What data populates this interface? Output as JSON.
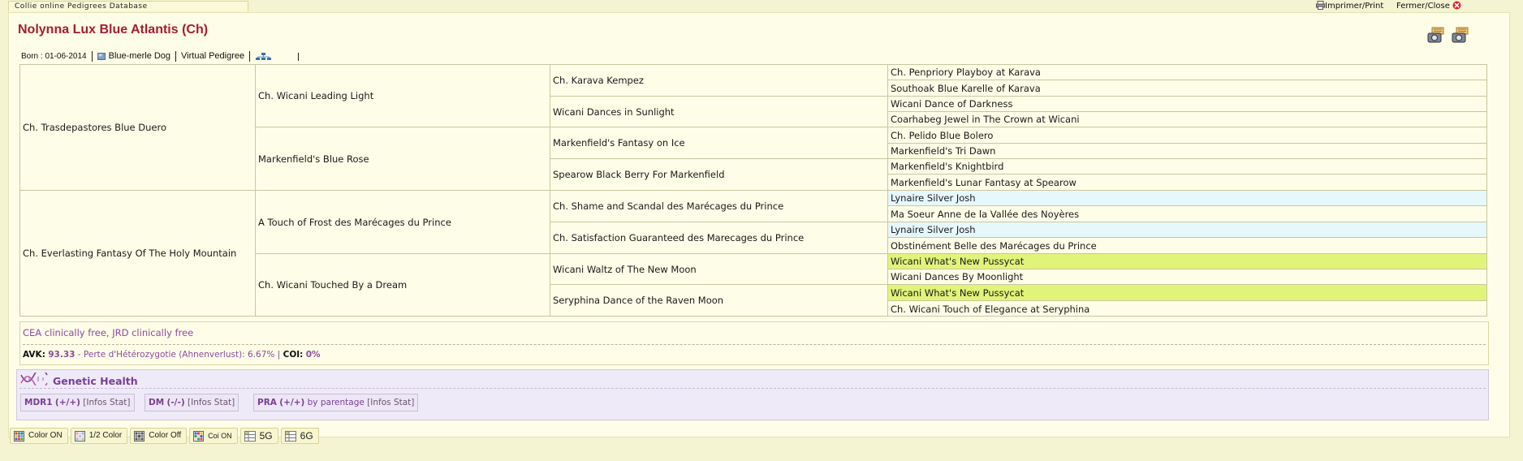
{
  "app": {
    "tab_title": "Collie online Pedigrees Database",
    "print_label": "Imprimer/Print",
    "close_label": "Fermer/Close"
  },
  "dog": {
    "title": "Nolynna Lux Blue Atlantis (Ch)",
    "born": "Born : 01-06-2014",
    "color_sex": "Blue-merle Dog",
    "virtual_pedigree": "Virtual Pedigree"
  },
  "pedigree": {
    "gen1": [
      "Ch. Trasdepastores Blue Duero",
      "Ch. Everlasting Fantasy Of The Holy Mountain"
    ],
    "gen2": [
      "Ch. Wicani Leading Light",
      "Markenfield's Blue Rose",
      "A Touch of Frost des Marécages du Prince",
      "Ch. Wicani Touched By a Dream"
    ],
    "gen3": [
      "Ch. Karava Kempez",
      "Wicani Dances in Sunlight",
      "Markenfield's Fantasy on Ice",
      "Spearow Black Berry For Markenfield",
      "Ch. Shame and Scandal des Marécages du Prince",
      "Ch. Satisfaction Guaranteed des Marecages du Prince",
      "Wicani Waltz of The New Moon",
      "Seryphina Dance of the Raven Moon"
    ],
    "gen4": [
      {
        "name": "Ch. Penpriory Playboy at Karava",
        "hl": ""
      },
      {
        "name": "Southoak Blue Karelle of Karava",
        "hl": ""
      },
      {
        "name": "Wicani Dance of Darkness",
        "hl": ""
      },
      {
        "name": "Coarhabeg Jewel in The Crown at Wicani",
        "hl": ""
      },
      {
        "name": "Ch. Pelido Blue Bolero",
        "hl": ""
      },
      {
        "name": "Markenfield's Tri Dawn",
        "hl": ""
      },
      {
        "name": "Markenfield's Knightbird",
        "hl": ""
      },
      {
        "name": "Markenfield's Lunar Fantasy at Spearow",
        "hl": ""
      },
      {
        "name": "Lynaire Silver Josh",
        "hl": "blue"
      },
      {
        "name": "Ma Soeur Anne de la Vallée des Noyères",
        "hl": ""
      },
      {
        "name": "Lynaire Silver Josh",
        "hl": "blue"
      },
      {
        "name": "Obstinément Belle des Marécages du Prince",
        "hl": ""
      },
      {
        "name": "Wicani What's New Pussycat",
        "hl": "yellow"
      },
      {
        "name": "Wicani Dances By Moonlight",
        "hl": ""
      },
      {
        "name": "Wicani What's New Pussycat",
        "hl": "yellow"
      },
      {
        "name": "Ch. Wicani Touch of Elegance at Seryphina",
        "hl": ""
      }
    ]
  },
  "health": {
    "clinical": "CEA clinically free, JRD clinically free",
    "avk_label": "AVK",
    "avk_value": "93.33",
    "perte": "- Perte d'Hétérozygotie (Ahnenverlust): 6.67% |",
    "coi_label": "COI",
    "coi_value": "0%",
    "genetic_title": "Genetic Health",
    "tests": [
      {
        "name": "MDR1",
        "result": "(+/+)",
        "extra": "",
        "links": "[Infos  Stat]"
      },
      {
        "name": "DM",
        "result": "(-/-)",
        "extra": "",
        "links": "[Infos  Stat]"
      },
      {
        "name": "PRA",
        "result": "(+/+)",
        "extra": "by parentage",
        "links": "[Infos  Stat]"
      }
    ]
  },
  "bottom": {
    "buttons": [
      "Color ON",
      "1/2 Color",
      "Color Off",
      "Coi ON",
      "5G",
      "6G"
    ]
  },
  "colors": {
    "title": "#a51d2c",
    "blue_highlight": "#e6f8fc",
    "yellow_highlight": "#e1f47a",
    "purple_text": "#8e4a9e"
  }
}
